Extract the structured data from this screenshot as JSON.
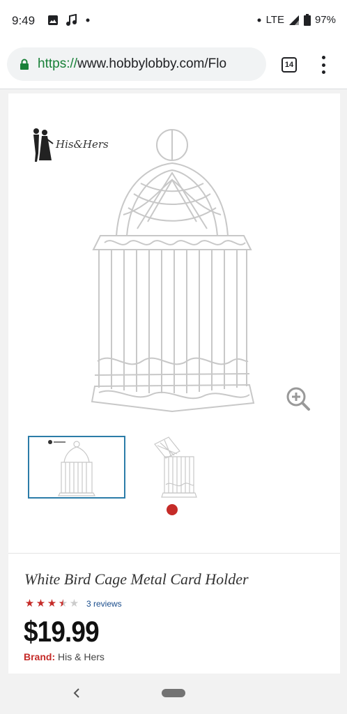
{
  "status_bar": {
    "time": "9:49",
    "network": "LTE",
    "battery": "97%",
    "icons": [
      "image-icon",
      "music-note-icon",
      "dot-icon",
      "signal-icon",
      "battery-icon"
    ]
  },
  "browser": {
    "url_scheme": "https://",
    "url_rest": "www.hobbylobby.com/Flo",
    "tab_count": "14",
    "icons": [
      "lock-icon",
      "menu-dots-icon"
    ]
  },
  "product": {
    "brand_logo_text": "His&Hers",
    "title": "White Bird Cage Metal Card Holder",
    "rating": 3.5,
    "rating_max": 5,
    "reviews_text": "3 reviews",
    "price": "$19.99",
    "brand_label": "Brand:",
    "brand_value": "His & Hers",
    "thumbnails": [
      "birdcage-closed",
      "birdcage-open"
    ],
    "selected_thumbnail": 0
  },
  "colors": {
    "accent_red": "#c52b28",
    "selected_border": "#2b7ca8",
    "link_blue": "#1a4d8c",
    "url_green": "#188038"
  },
  "nav": {
    "icons": [
      "back-icon",
      "home-pill"
    ]
  }
}
